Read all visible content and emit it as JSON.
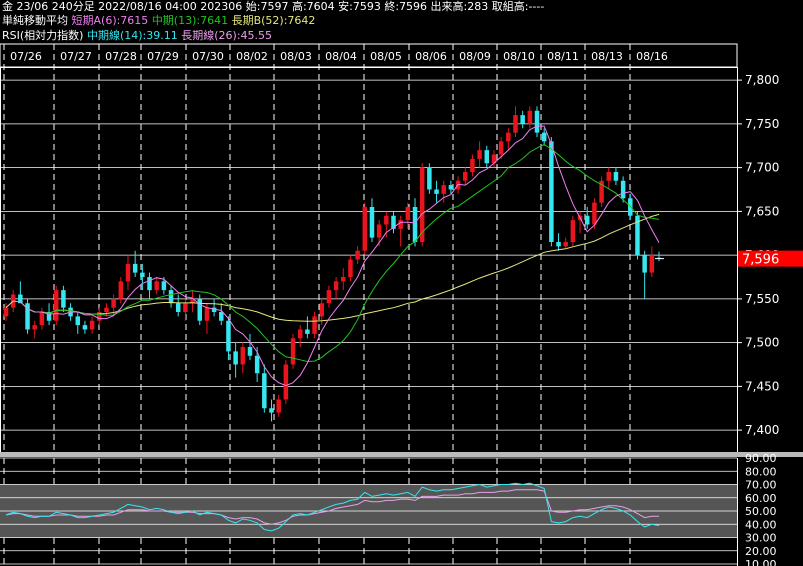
{
  "header": {
    "line1": "金 23/06 240分足 2022/08/16 04:00 202306 始:7597 高:7604 安:7593 終:7596 出来高:283 取組高:----",
    "ma_title": "単純移動平均",
    "ma_short_label": "短期A(6):7615",
    "ma_mid_label": "中期(13):7641",
    "ma_long_label": "長期B(52):7642",
    "rsi_title": "RSI(相対力指数)",
    "rsi_mid_label": "中期線(14):39.11",
    "rsi_long_label": "長期線(26):45.55"
  },
  "colors": {
    "up": "#e8141e",
    "down": "#36e6f0",
    "ma_short": "#f07ff0",
    "ma_mid": "#22c422",
    "ma_long": "#e6e67a",
    "rsi_mid": "#36e6f0",
    "rsi_long": "#e8a0e8",
    "price_tag": "#ff0000"
  },
  "chart_data": {
    "type": "candlestick",
    "x_labels": [
      "07/26",
      "07/27",
      "07/28",
      "07/29",
      "07/30",
      "08/02",
      "08/03",
      "08/04",
      "08/05",
      "08/06",
      "08/09",
      "08/10",
      "08/11",
      "08/13",
      "08/16"
    ],
    "y_ticks": [
      7400,
      7450,
      7500,
      7550,
      7600,
      7650,
      7700,
      7750,
      7800
    ],
    "ylim": [
      7375,
      7815
    ],
    "last_price": "7,596",
    "candles": [
      [
        7530,
        7545,
        7525,
        7540
      ],
      [
        7540,
        7560,
        7535,
        7555
      ],
      [
        7555,
        7570,
        7550,
        7545
      ],
      [
        7545,
        7550,
        7510,
        7515
      ],
      [
        7515,
        7525,
        7505,
        7520
      ],
      [
        7520,
        7540,
        7515,
        7535
      ],
      [
        7535,
        7545,
        7520,
        7525
      ],
      [
        7525,
        7565,
        7520,
        7560
      ],
      [
        7560,
        7565,
        7535,
        7540
      ],
      [
        7540,
        7545,
        7525,
        7530
      ],
      [
        7530,
        7535,
        7510,
        7520
      ],
      [
        7520,
        7525,
        7510,
        7515
      ],
      [
        7515,
        7530,
        7510,
        7525
      ],
      [
        7525,
        7540,
        7520,
        7535
      ],
      [
        7535,
        7545,
        7530,
        7540
      ],
      [
        7540,
        7555,
        7530,
        7550
      ],
      [
        7550,
        7575,
        7545,
        7570
      ],
      [
        7570,
        7600,
        7560,
        7590
      ],
      [
        7590,
        7605,
        7575,
        7580
      ],
      [
        7580,
        7590,
        7560,
        7575
      ],
      [
        7575,
        7580,
        7550,
        7560
      ],
      [
        7560,
        7575,
        7555,
        7570
      ],
      [
        7570,
        7575,
        7555,
        7560
      ],
      [
        7560,
        7565,
        7540,
        7545
      ],
      [
        7545,
        7555,
        7530,
        7535
      ],
      [
        7535,
        7550,
        7525,
        7545
      ],
      [
        7545,
        7560,
        7535,
        7550
      ],
      [
        7550,
        7555,
        7520,
        7525
      ],
      [
        7525,
        7545,
        7510,
        7540
      ],
      [
        7540,
        7550,
        7530,
        7535
      ],
      [
        7535,
        7545,
        7520,
        7525
      ],
      [
        7525,
        7530,
        7480,
        7490
      ],
      [
        7490,
        7500,
        7460,
        7475
      ],
      [
        7475,
        7500,
        7465,
        7495
      ],
      [
        7495,
        7510,
        7480,
        7485
      ],
      [
        7485,
        7495,
        7455,
        7465
      ],
      [
        7465,
        7475,
        7420,
        7425
      ],
      [
        7425,
        7435,
        7410,
        7420
      ],
      [
        7420,
        7440,
        7415,
        7435
      ],
      [
        7435,
        7480,
        7430,
        7475
      ],
      [
        7475,
        7510,
        7470,
        7505
      ],
      [
        7505,
        7520,
        7495,
        7515
      ],
      [
        7515,
        7530,
        7505,
        7510
      ],
      [
        7510,
        7535,
        7505,
        7530
      ],
      [
        7530,
        7550,
        7520,
        7545
      ],
      [
        7545,
        7565,
        7540,
        7560
      ],
      [
        7560,
        7575,
        7550,
        7570
      ],
      [
        7570,
        7585,
        7560,
        7575
      ],
      [
        7575,
        7600,
        7570,
        7595
      ],
      [
        7595,
        7610,
        7590,
        7605
      ],
      [
        7605,
        7660,
        7600,
        7655
      ],
      [
        7655,
        7665,
        7615,
        7620
      ],
      [
        7620,
        7640,
        7610,
        7635
      ],
      [
        7635,
        7650,
        7620,
        7645
      ],
      [
        7645,
        7650,
        7625,
        7630
      ],
      [
        7630,
        7645,
        7610,
        7640
      ],
      [
        7640,
        7660,
        7630,
        7655
      ],
      [
        7655,
        7665,
        7610,
        7615
      ],
      [
        7615,
        7705,
        7610,
        7700
      ],
      [
        7700,
        7705,
        7670,
        7675
      ],
      [
        7675,
        7685,
        7660,
        7670
      ],
      [
        7670,
        7685,
        7660,
        7680
      ],
      [
        7680,
        7685,
        7670,
        7675
      ],
      [
        7675,
        7690,
        7670,
        7685
      ],
      [
        7685,
        7700,
        7680,
        7695
      ],
      [
        7695,
        7715,
        7690,
        7710
      ],
      [
        7710,
        7730,
        7700,
        7720
      ],
      [
        7720,
        7725,
        7700,
        7705
      ],
      [
        7705,
        7720,
        7700,
        7715
      ],
      [
        7715,
        7735,
        7710,
        7730
      ],
      [
        7730,
        7745,
        7720,
        7740
      ],
      [
        7740,
        7770,
        7735,
        7760
      ],
      [
        7760,
        7765,
        7745,
        7750
      ],
      [
        7750,
        7770,
        7745,
        7765
      ],
      [
        7765,
        7770,
        7735,
        7740
      ],
      [
        7740,
        7745,
        7725,
        7730
      ],
      [
        7730,
        7735,
        7610,
        7615
      ],
      [
        7615,
        7625,
        7605,
        7610
      ],
      [
        7610,
        7620,
        7608,
        7615
      ],
      [
        7615,
        7645,
        7610,
        7640
      ],
      [
        7640,
        7650,
        7625,
        7645
      ],
      [
        7645,
        7655,
        7630,
        7635
      ],
      [
        7635,
        7665,
        7630,
        7660
      ],
      [
        7660,
        7690,
        7655,
        7685
      ],
      [
        7685,
        7700,
        7675,
        7695
      ],
      [
        7695,
        7700,
        7680,
        7685
      ],
      [
        7685,
        7690,
        7660,
        7665
      ],
      [
        7665,
        7670,
        7640,
        7645
      ],
      [
        7645,
        7650,
        7595,
        7600
      ],
      [
        7600,
        7605,
        7550,
        7580
      ],
      [
        7580,
        7610,
        7575,
        7600
      ],
      [
        7597,
        7604,
        7593,
        7596
      ]
    ],
    "rsi": {
      "y_ticks": [
        10,
        20,
        30,
        40,
        50,
        60,
        70,
        80,
        90
      ],
      "ylim": [
        10,
        90
      ],
      "bands": [
        30,
        70
      ],
      "mid_values": [
        47,
        49,
        48,
        46,
        45,
        46,
        46,
        49,
        48,
        47,
        45,
        45,
        46,
        47,
        48,
        49,
        52,
        55,
        54,
        53,
        51,
        52,
        51,
        49,
        48,
        49,
        50,
        47,
        49,
        48,
        47,
        43,
        41,
        44,
        43,
        41,
        36,
        35,
        37,
        42,
        47,
        48,
        47,
        49,
        51,
        53,
        55,
        56,
        58,
        59,
        64,
        61,
        62,
        63,
        62,
        63,
        64,
        61,
        68,
        66,
        65,
        66,
        66,
        67,
        68,
        69,
        70,
        68,
        69,
        70,
        70,
        71,
        70,
        71,
        69,
        67,
        42,
        41,
        42,
        45,
        46,
        45,
        48,
        51,
        53,
        52,
        50,
        47,
        42,
        38,
        40,
        39
      ],
      "long_values": [
        47,
        48,
        48,
        47,
        46,
        46,
        46,
        47,
        47,
        47,
        46,
        46,
        46,
        46,
        47,
        47,
        49,
        51,
        51,
        51,
        50,
        50,
        50,
        49,
        49,
        49,
        49,
        48,
        48,
        48,
        47,
        45,
        44,
        45,
        45,
        44,
        41,
        40,
        41,
        43,
        46,
        47,
        47,
        48,
        49,
        50,
        52,
        53,
        54,
        55,
        58,
        57,
        57,
        58,
        58,
        59,
        59,
        58,
        61,
        61,
        61,
        62,
        62,
        62,
        63,
        63,
        64,
        64,
        64,
        65,
        65,
        66,
        66,
        66,
        66,
        65,
        50,
        49,
        49,
        50,
        51,
        51,
        52,
        53,
        54,
        54,
        53,
        51,
        48,
        45,
        46,
        46
      ]
    }
  }
}
